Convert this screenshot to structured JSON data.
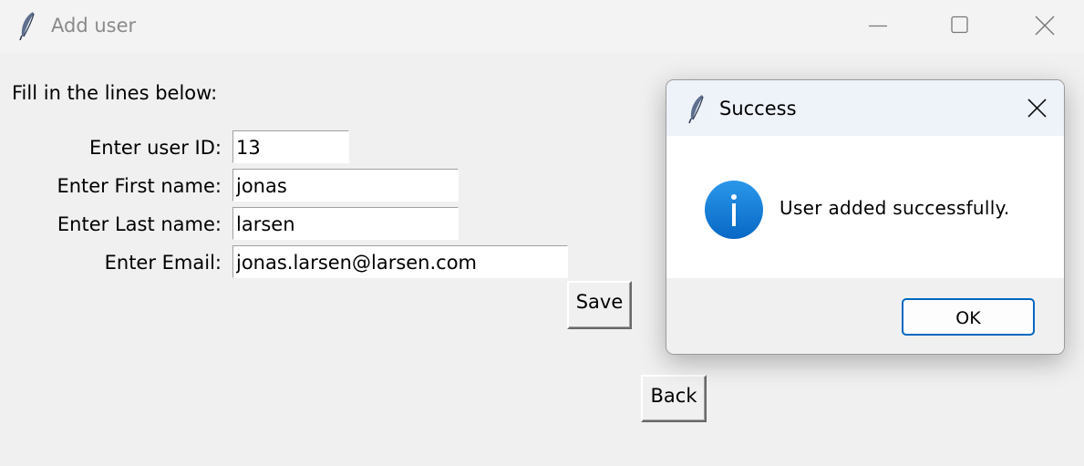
{
  "window": {
    "title": "Add user"
  },
  "form": {
    "instruction": "Fill in the lines below:",
    "fields": [
      {
        "label": "Enter user ID:",
        "value": "13"
      },
      {
        "label": "Enter First name:",
        "value": "jonas"
      },
      {
        "label": "Enter Last name:",
        "value": "larsen"
      },
      {
        "label": "Enter Email:",
        "value": "jonas.larsen@larsen.com"
      }
    ],
    "save_label": "Save",
    "back_label": "Back"
  },
  "dialog": {
    "title": "Success",
    "message": "User added successfully.",
    "ok_label": "OK",
    "icon": "info-icon"
  },
  "colors": {
    "background": "#f0f0f0",
    "dialog_titlebar": "#eef2f9",
    "info_icon": "#0f7dd4",
    "ok_border": "#0067c0"
  }
}
